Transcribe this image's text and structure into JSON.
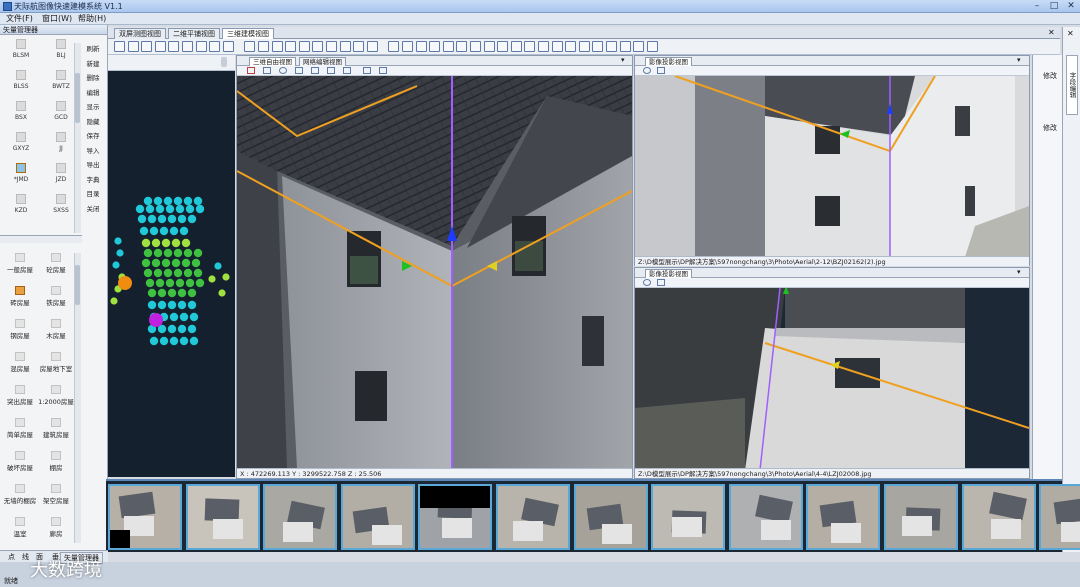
{
  "window": {
    "title": "天际航图像快速建模系统 V1.1"
  },
  "menu": [
    "文件(F)",
    "窗口(W)",
    "帮助(H)"
  ],
  "left_panel": {
    "title": "矢量管理器",
    "layers": [
      "BLSM",
      "BLJ",
      "BLSS",
      "BWTZ",
      "BSX",
      "GCD",
      "GXYZ",
      "JJ",
      "*JMD",
      "JZD",
      "KZD",
      "SXSS"
    ],
    "side_commands": [
      "刷新",
      "新建",
      "删除",
      "编辑",
      "显示",
      "隐藏",
      "保存",
      "导入",
      "导出",
      "字典",
      "目录",
      "关闭"
    ],
    "buildings": [
      "一般房屋",
      "砼房屋",
      "砖房屋",
      "铁房屋",
      "钢房屋",
      "木房屋",
      "混房屋",
      "房屋地下室",
      "突出房屋",
      "1:2000房屋",
      "简单房屋",
      "建筑房屋",
      "破坏房屋",
      "棚房",
      "无墙的棚房",
      "架空房屋",
      "温室",
      "廊房"
    ],
    "bottom_tabs": [
      "点",
      "线",
      "面",
      "垂直辅助线"
    ],
    "bottom_label": "矢量管理器"
  },
  "tabs": [
    "双屏测图视图",
    "二维平铺视图",
    "三维建模视图"
  ],
  "main_view": {
    "subtabs": [
      "三维自由视图",
      "网络编辑视图"
    ],
    "status": "X : 472269.113  Y : 3299522.758  Z : 25.506"
  },
  "image_view_top": {
    "tab": "影像投影视图",
    "path": "Z:\\D模型展示\\DP解决方案\\597nongchang\\3\\Photo\\Aerial\\2-12\\BZJ02162(2).jpg"
  },
  "image_view_bottom": {
    "tab": "影像投影视图",
    "path": "Z:\\D模型展示\\DP解决方案\\597nongchang\\3\\Photo\\Aerial\\4-4\\LZJ02008.jpg"
  },
  "right_panel": {
    "labels": [
      "修改",
      "修改"
    ],
    "vertical_tab": "字段编辑"
  },
  "status": {
    "ready": "就绪"
  },
  "watermark": "大数跨境",
  "colors": {
    "accent": "#5aa8d8",
    "ridge_line": "#f0a020",
    "axis_blue": "#1e3cff",
    "axis_green": "#20c020",
    "axis_purple": "#a060ff"
  }
}
